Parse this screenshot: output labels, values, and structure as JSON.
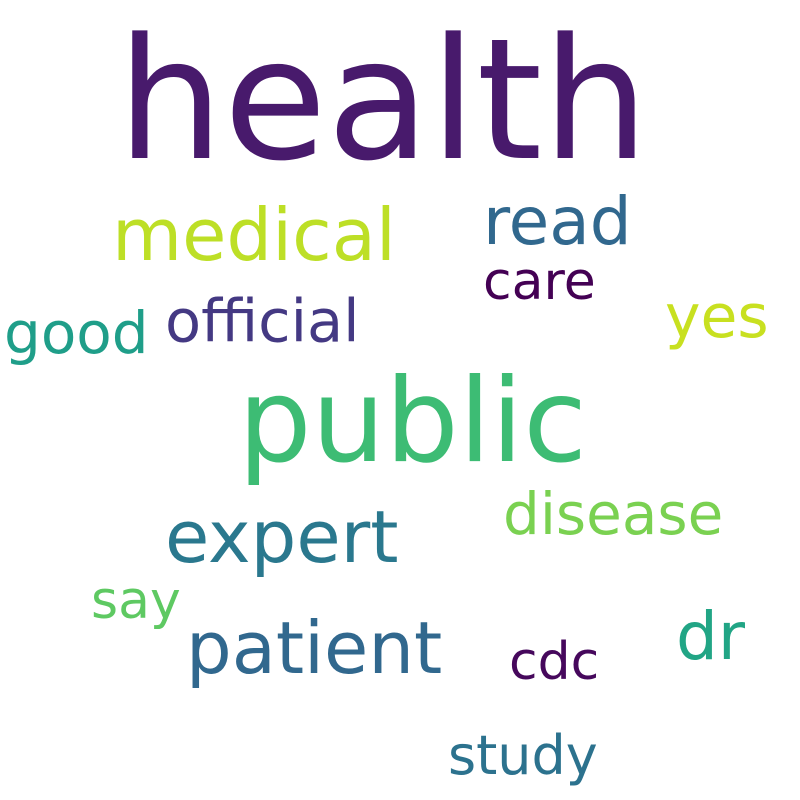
{
  "words": [
    {
      "text": "health",
      "color": "#481a6c"
    },
    {
      "text": "public",
      "color": "#3dbc74"
    },
    {
      "text": "medical",
      "color": "#bddf26"
    },
    {
      "text": "expert",
      "color": "#2a788e"
    },
    {
      "text": "patient",
      "color": "#31688e"
    },
    {
      "text": "read",
      "color": "#31688e"
    },
    {
      "text": "official",
      "color": "#443983"
    },
    {
      "text": "dr",
      "color": "#21a585"
    },
    {
      "text": "disease",
      "color": "#7ad151"
    },
    {
      "text": "yes",
      "color": "#c8e020"
    },
    {
      "text": "good",
      "color": "#1f9e89"
    },
    {
      "text": "care",
      "color": "#440154"
    },
    {
      "text": "study",
      "color": "#2c728e"
    },
    {
      "text": "cdc",
      "color": "#46085c"
    },
    {
      "text": "say",
      "color": "#5ec962"
    }
  ]
}
